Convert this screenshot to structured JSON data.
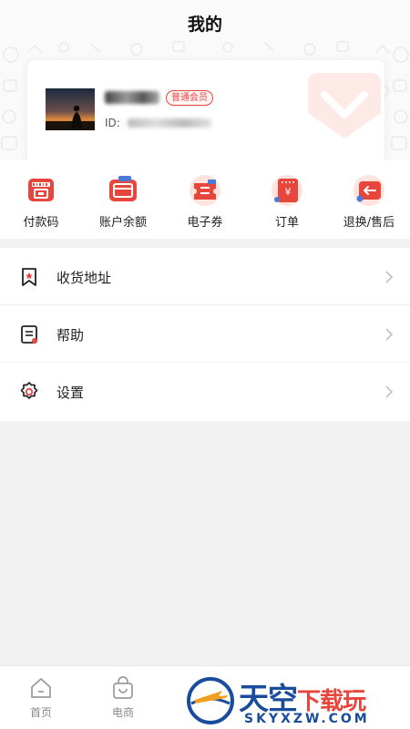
{
  "page": {
    "title": "我的"
  },
  "profile": {
    "badge": "普通会员",
    "id_label": "ID:"
  },
  "quick_menu": [
    {
      "label": "付款码",
      "icon": "payment-code-icon"
    },
    {
      "label": "账户余额",
      "icon": "wallet-card-icon"
    },
    {
      "label": "电子券",
      "icon": "coupon-ticket-icon"
    },
    {
      "label": "订单",
      "icon": "order-receipt-icon"
    },
    {
      "label": "退换/售后",
      "icon": "return-refund-icon"
    }
  ],
  "list_menu": [
    {
      "label": "收货地址",
      "icon": "address-bookmark-icon"
    },
    {
      "label": "帮助",
      "icon": "help-document-icon"
    },
    {
      "label": "设置",
      "icon": "settings-gear-icon"
    }
  ],
  "tabbar": [
    {
      "label": "首页",
      "icon": "home-icon"
    },
    {
      "label": "电商",
      "icon": "shopping-bag-icon"
    }
  ],
  "watermark": {
    "title_main": "天空",
    "title_accent": "下载玩",
    "url": "SKYXZW.COM"
  },
  "colors": {
    "accent": "#e8453c",
    "accent_light": "#ffe3dc",
    "watermark_blue": "#1a4c9c",
    "background": "#f2f2f2"
  }
}
